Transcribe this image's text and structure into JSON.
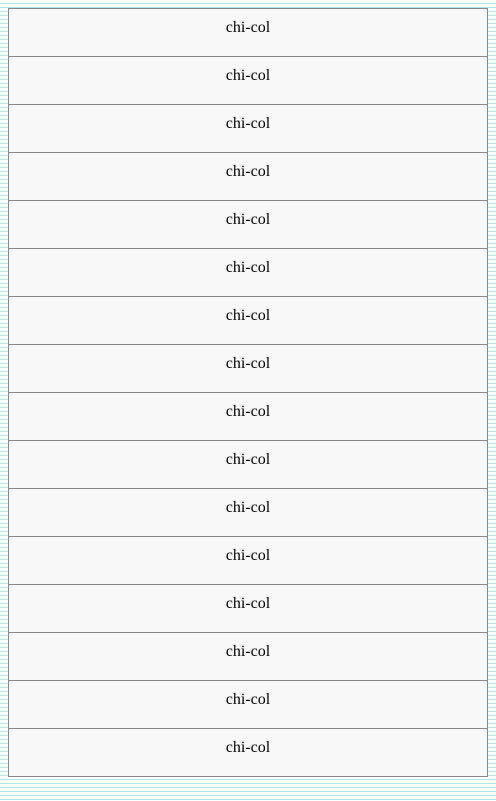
{
  "column": {
    "items": [
      {
        "label": "chi-col"
      },
      {
        "label": "chi-col"
      },
      {
        "label": "chi-col"
      },
      {
        "label": "chi-col"
      },
      {
        "label": "chi-col"
      },
      {
        "label": "chi-col"
      },
      {
        "label": "chi-col"
      },
      {
        "label": "chi-col"
      },
      {
        "label": "chi-col"
      },
      {
        "label": "chi-col"
      },
      {
        "label": "chi-col"
      },
      {
        "label": "chi-col"
      },
      {
        "label": "chi-col"
      },
      {
        "label": "chi-col"
      },
      {
        "label": "chi-col"
      },
      {
        "label": "chi-col"
      }
    ]
  },
  "colors": {
    "background": "#ffffff",
    "stripe": "#a8ece6",
    "row_background": "#f8f8f8",
    "row_border": "#888888"
  }
}
